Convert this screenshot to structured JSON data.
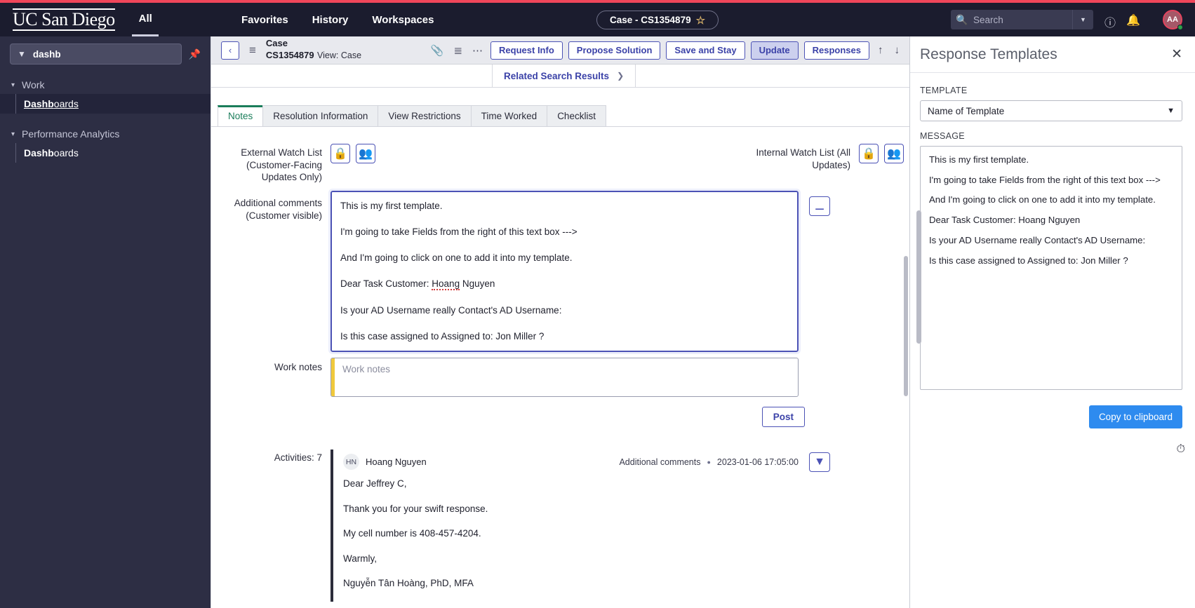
{
  "global_nav": {
    "logo": "UC San Diego",
    "all_label": "All",
    "links": [
      "Favorites",
      "History",
      "Workspaces"
    ],
    "case_pill": "Case - CS1354879",
    "star_icon": "star-outline-icon",
    "search_placeholder": "Search",
    "avatar_initials": "AA",
    "accent_red": "#f0465a",
    "nav_bg": "#1b1c2e"
  },
  "sidebar": {
    "filter_value": "dashb",
    "filter_icon": "filter-icon",
    "pin_icon": "pin-icon",
    "groups": [
      {
        "label": "Work",
        "items": [
          {
            "bold": "Dashb",
            "rest": "oards",
            "active": true
          }
        ]
      },
      {
        "label": "Performance Analytics",
        "items": [
          {
            "bold": "Dashb",
            "rest": "oards",
            "active": false
          }
        ]
      }
    ]
  },
  "form_toolbar": {
    "back_icon": "chevron-left-icon",
    "menu_icon": "hamburger-menu-icon",
    "record_type": "Case",
    "record_number": "CS1354879",
    "record_view": "View: Case",
    "attach_icon": "paperclip-icon",
    "prefs_icon": "sliders-icon",
    "more_icon": "ellipsis-icon",
    "buttons": [
      "Request Info",
      "Propose Solution",
      "Save and Stay",
      "Update",
      "Responses"
    ],
    "primary_button": "Update",
    "up_icon": "arrow-up-icon",
    "down_icon": "arrow-down-icon",
    "related_search": "Related Search Results",
    "related_search_caret": "chevron-right-icon"
  },
  "tabs": [
    {
      "label": "Notes",
      "active": true
    },
    {
      "label": "Resolution Information",
      "active": false
    },
    {
      "label": "View Restrictions",
      "active": false
    },
    {
      "label": "Time Worked",
      "active": false
    },
    {
      "label": "Checklist",
      "active": false
    }
  ],
  "notes": {
    "external_watch_label": "External Watch List (Customer-Facing Updates Only)",
    "internal_watch_label": "Internal Watch List (All Updates)",
    "lock_icon": "lock-icon",
    "add_user_icon": "add-user-icon",
    "comments_label": "Additional comments (Customer visible)",
    "comments_lines": [
      "This is my first template.",
      "I'm going to take Fields from the right of this text box --->",
      "And I'm going to click on one to add it into my template.",
      "Dear Task Customer: Hoang Nguyen",
      "Is your AD Username really Contact's AD Username:",
      "Is this case assigned to Assigned to: Jon Miller ?"
    ],
    "comments_side_icon": "expand-text-icon",
    "work_notes_label": "Work notes",
    "work_notes_placeholder": "Work notes",
    "work_notes_value": "",
    "post_label": "Post",
    "activities_label": "Activities: 7",
    "activity_filter_icon": "filter-icon",
    "activity": {
      "avatar_initials": "HN",
      "author": "Hoang Nguyen",
      "type": "Additional comments",
      "timestamp": "2023-01-06 17:05:00",
      "lines": [
        "Dear Jeffrey C,",
        "Thank you for your swift response.",
        "My cell number is 408-457-4204.",
        "Warmly,",
        "Nguyễn Tân Hoàng, PhD, MFA"
      ]
    }
  },
  "response_templates": {
    "title": "Response Templates",
    "close_icon": "close-icon",
    "template_label": "TEMPLATE",
    "template_value": "Name of Template",
    "template_caret": "chevron-down-icon",
    "message_label": "MESSAGE",
    "message_lines": [
      "This is my first template.",
      "I'm going to take Fields from the right of this text box --->",
      "And I'm going to click on one to add it into my template.",
      "Dear Task Customer: Hoang Nguyen",
      "Is your AD Username really Contact's AD Username:",
      "Is this case assigned to Assigned to: Jon Miller ?"
    ],
    "copy_label": "Copy to clipboard",
    "copy_color": "#2e8bef",
    "timer_icon": "stopwatch-icon"
  }
}
